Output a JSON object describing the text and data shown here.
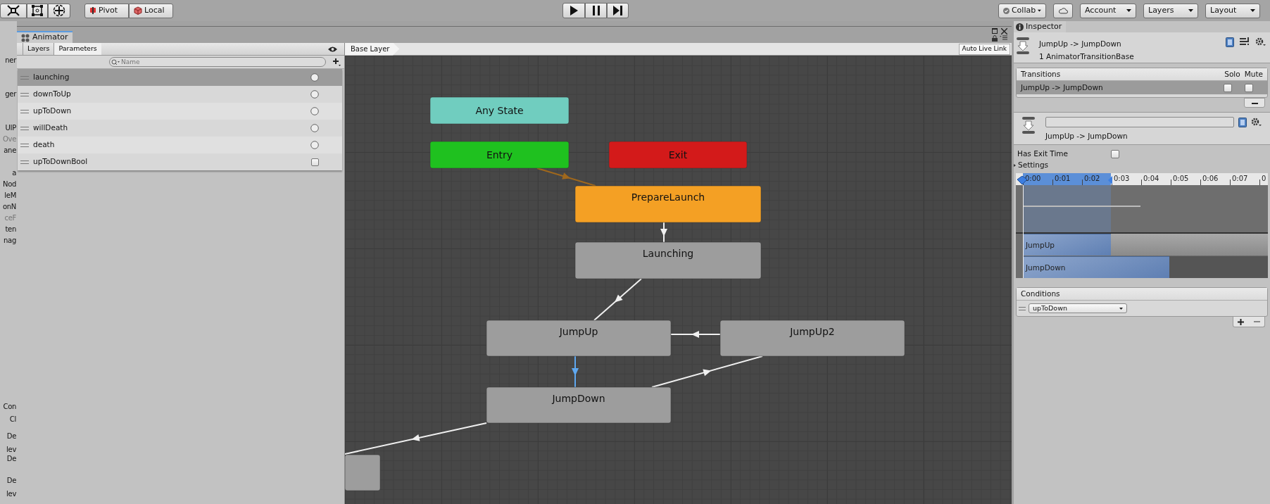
{
  "left_strip": {
    "upper": [
      {
        "text": "ner",
        "kind": "normal"
      },
      {
        "text": "ger",
        "kind": "normal"
      },
      {
        "text": "UIP",
        "kind": "normal"
      },
      {
        "text": "Ove",
        "kind": "muted"
      },
      {
        "text": "ane",
        "kind": "normal"
      },
      {
        "text": "a",
        "kind": "normal"
      },
      {
        "text": "Nod",
        "kind": "normal"
      },
      {
        "text": "leM",
        "kind": "normal"
      },
      {
        "text": "onN",
        "kind": "normal"
      },
      {
        "text": "ceF",
        "kind": "muted"
      },
      {
        "text": "ten",
        "kind": "normal"
      },
      {
        "text": "nag",
        "kind": "normal"
      }
    ],
    "lower": [
      "Con",
      "Cl",
      "De",
      "lev",
      "De",
      "De",
      "lev"
    ]
  },
  "toolbar": {
    "handle_buttons": [
      "Pivot",
      "Local"
    ],
    "right_buttons": [
      {
        "kind": "collab",
        "label": "Collab"
      },
      {
        "kind": "cloud"
      },
      {
        "kind": "menu",
        "label": "Account"
      },
      {
        "kind": "menu",
        "label": "Layers"
      },
      {
        "kind": "menu",
        "label": "Layout"
      }
    ]
  },
  "animator": {
    "tab": "Animator",
    "panel_tabs": [
      {
        "label": "Layers",
        "selected": false
      },
      {
        "label": "Parameters",
        "selected": true
      }
    ],
    "search": {
      "placeholder": "Name"
    },
    "parameters": [
      {
        "name": "launching",
        "kind": "trigger",
        "selected": true
      },
      {
        "name": "downToUp",
        "kind": "trigger",
        "selected": false
      },
      {
        "name": "upToDown",
        "kind": "trigger",
        "selected": false
      },
      {
        "name": "willDeath",
        "kind": "trigger",
        "selected": false
      },
      {
        "name": "death",
        "kind": "trigger",
        "selected": false
      },
      {
        "name": "upToDownBool",
        "kind": "bool",
        "selected": false
      }
    ],
    "breadcrumb": "Base Layer",
    "live_link_button": "Auto Live Link",
    "states": [
      {
        "label": "Any State",
        "color": "#70cdbf"
      },
      {
        "label": "Entry",
        "color": "#1fc11f"
      },
      {
        "label": "Exit",
        "color": "#d31a1a"
      },
      {
        "label": "PrepareLaunch",
        "color": "#f4a024"
      },
      {
        "label": "Launching",
        "color": "#9d9d9d"
      },
      {
        "label": "JumpUp",
        "color": "#9d9d9d"
      },
      {
        "label": "JumpUp2",
        "color": "#9d9d9d"
      },
      {
        "label": "JumpDown",
        "color": "#9d9d9d"
      },
      {
        "color": "#9d9d9d"
      }
    ],
    "transitions": [
      {
        "kind": "default",
        "selected": false
      },
      {
        "kind": "normal",
        "selected": false
      },
      {
        "kind": "normal",
        "selected": false
      },
      {
        "kind": "normal",
        "selected": false
      },
      {
        "kind": "normal",
        "selected": true
      },
      {
        "kind": "normal",
        "selected": false
      },
      {
        "kind": "normal",
        "selected": false
      }
    ]
  },
  "inspector": {
    "tab": "Inspector",
    "title": "JumpUp -> JumpDown",
    "subtitle": "1 AnimatorTransitionBase",
    "transitions_list": {
      "heading": "Transitions",
      "solo_label": "Solo",
      "mute_label": "Mute",
      "rows": [
        {
          "name": "JumpUp -> JumpDown",
          "selected": true,
          "solo": false,
          "mute": false
        }
      ]
    },
    "transition_label": "JumpUp -> JumpDown",
    "has_exit_time": {
      "label": "Has Exit Time",
      "checked": false
    },
    "settings": {
      "label": "Settings",
      "expanded": false
    },
    "timeline": {
      "ticks": [
        "0:00",
        "0:01",
        "0:02",
        "0:03",
        "0:04",
        "0:05",
        "0:06",
        "0:07",
        "0"
      ],
      "tracks": [
        "JumpUp",
        "JumpDown"
      ]
    },
    "conditions": {
      "heading": "Conditions",
      "rows": [
        {
          "parameter": "upToDown"
        }
      ]
    }
  }
}
